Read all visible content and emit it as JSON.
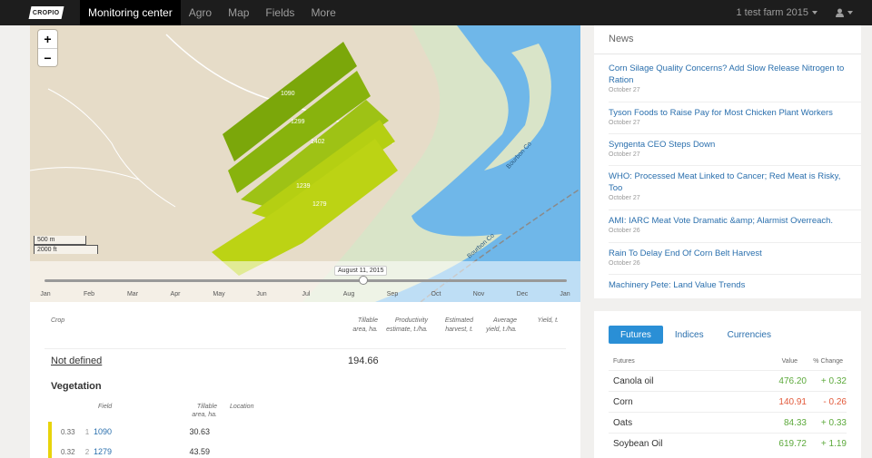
{
  "nav": {
    "logo": "CROPIO",
    "items": [
      "Monitoring center",
      "Agro",
      "Map",
      "Fields",
      "More"
    ],
    "farm": "1 test farm 2015"
  },
  "map": {
    "zoom_in": "+",
    "zoom_out": "−",
    "scale_m": "500 m",
    "scale_ft": "2000 ft",
    "timeline_date": "August 11, 2015",
    "timeline_progress": 0.61,
    "months": [
      "Jan",
      "Feb",
      "Mar",
      "Apr",
      "May",
      "Jun",
      "Jul",
      "Aug",
      "Sep",
      "Oct",
      "Nov",
      "Dec",
      "Jan"
    ],
    "field_labels": [
      "1090",
      "1299",
      "1402",
      "1239",
      "1279"
    ],
    "road_label_1": "Bourbon Co",
    "road_label_2": "Bourbon Co"
  },
  "crop_table": {
    "headers": {
      "crop": "Crop",
      "tillable": "Tillable area, ha.",
      "productivity": "Productivity estimate, t./ha.",
      "harvest": "Estimated harvest, t.",
      "avg_yield": "Average yield, t./ha.",
      "yield": "Yield, t."
    },
    "not_defined": {
      "label": "Not defined",
      "area": "194.66"
    },
    "vegetation_title": "Vegetation",
    "veg_headers": {
      "field": "Field",
      "tillable": "Tillable area, ha.",
      "location": "Location"
    },
    "veg_rows": [
      {
        "ndvi": "0.33",
        "idx": "1",
        "field": "1090",
        "area": "30.63"
      },
      {
        "ndvi": "0.32",
        "idx": "2",
        "field": "1279",
        "area": "43.59"
      }
    ]
  },
  "news": {
    "title": "News",
    "items": [
      {
        "title": "Corn Silage Quality Concerns? Add Slow Release Nitrogen to Ration",
        "date": "October 27"
      },
      {
        "title": "Tyson Foods to Raise Pay for Most Chicken Plant Workers",
        "date": "October 27"
      },
      {
        "title": "Syngenta CEO Steps Down",
        "date": "October 27"
      },
      {
        "title": "WHO: Processed Meat Linked to Cancer; Red Meat is Risky, Too",
        "date": "October 27"
      },
      {
        "title": "AMI: IARC Meat Vote Dramatic &amp; Alarmist Overreach.",
        "date": "October 26"
      },
      {
        "title": "Rain To Delay End Of Corn Belt Harvest",
        "date": "October 26"
      },
      {
        "title": "Machinery Pete: Land Value Trends",
        "date": ""
      }
    ]
  },
  "futures": {
    "tabs": [
      "Futures",
      "Indices",
      "Currencies"
    ],
    "headers": {
      "name": "Futures",
      "value": "Value",
      "change": "% Change"
    },
    "rows": [
      {
        "name": "Canola oil",
        "value": "476.20",
        "change": "+ 0.32",
        "dir": "up"
      },
      {
        "name": "Corn",
        "value": "140.91",
        "change": "- 0.26",
        "dir": "down"
      },
      {
        "name": "Oats",
        "value": "84.33",
        "change": "+ 0.33",
        "dir": "up"
      },
      {
        "name": "Soybean Oil",
        "value": "619.72",
        "change": "+ 1.19",
        "dir": "up"
      }
    ],
    "colors": {
      "up": "#5ca93b",
      "down": "#e2593a"
    }
  }
}
